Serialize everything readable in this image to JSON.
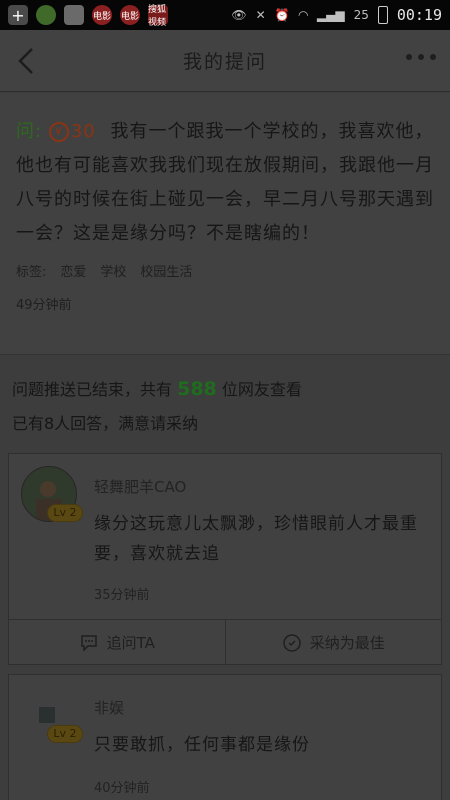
{
  "status_bar": {
    "apps": [
      "+",
      "",
      "",
      "",
      "",
      "",
      "搜狐视频"
    ],
    "notif_labels": [
      "电影",
      "电影"
    ],
    "battery": "25",
    "time": "00:19"
  },
  "header": {
    "title": "我的提问"
  },
  "question": {
    "label": "问:",
    "reward": "30",
    "text": "我有一个跟我一个学校的，我喜欢他，他也有可能喜欢我我们现在放假期间，我跟他一月八号的时候在街上碰见一会，早二月八号那天遇到一会？这是是缘分吗？不是瞎编的！",
    "tags_label": "标签:",
    "tags": [
      "恋爱",
      "学校",
      "校园生活"
    ],
    "time": "49分钟前"
  },
  "push_info": {
    "prefix": "问题推送已结束，共有",
    "count": "588",
    "suffix": "位网友查看",
    "answers": "已有8人回答，满意请采纳"
  },
  "answers": [
    {
      "username": "轻舞肥羊CAO",
      "level": "Lv 2",
      "text": "缘分这玩意儿太飘渺，珍惜眼前人才最重要，喜欢就去追",
      "time": "35分钟前"
    },
    {
      "username": "非娱",
      "level": "Lv 2",
      "text": "只要敢抓，任何事都是缘份",
      "time": "40分钟前"
    }
  ],
  "actions": {
    "ask": "追问TA",
    "adopt": "采纳为最佳"
  },
  "colors": {
    "accent_green": "#1f6c1f",
    "reward_orange": "#8b3414",
    "status_bar": "#060606"
  }
}
